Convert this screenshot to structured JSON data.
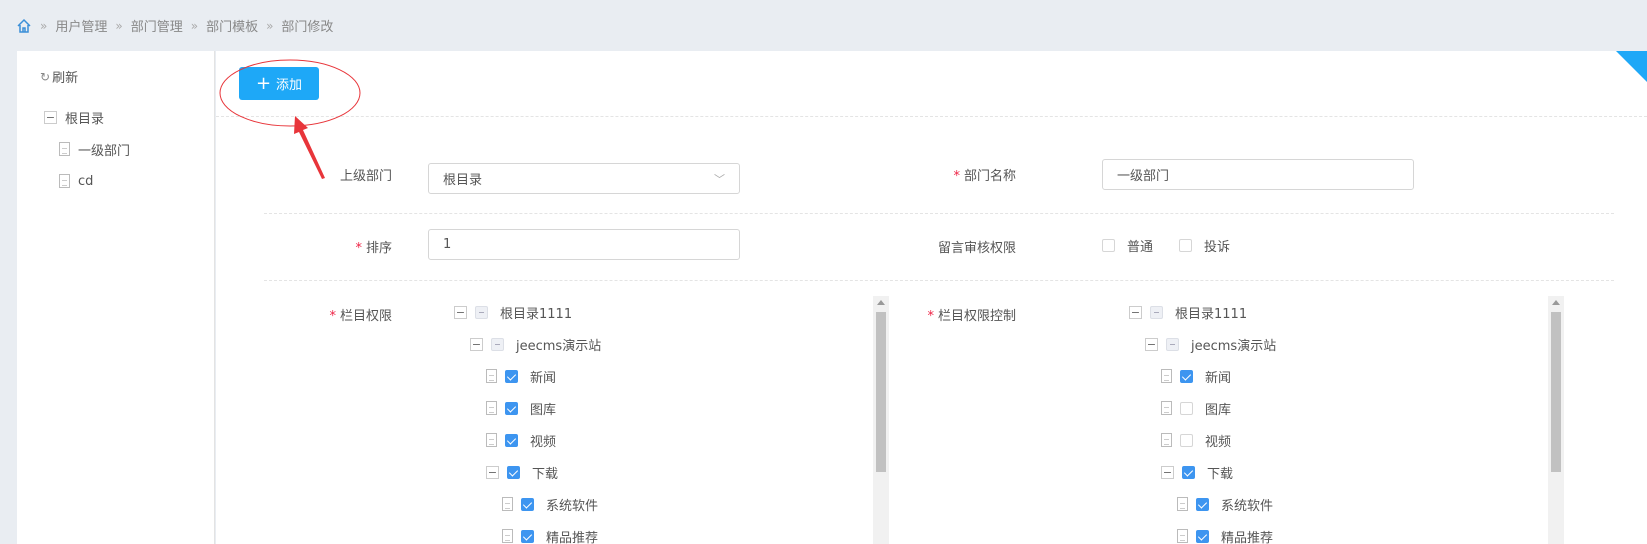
{
  "breadcrumb": [
    "用户管理",
    "部门管理",
    "部门模板",
    "部门修改"
  ],
  "sidebar": {
    "refresh": "刷新",
    "root": "根目录",
    "items": [
      "一级部门",
      "cd"
    ]
  },
  "toolbar": {
    "add_label": "添加"
  },
  "form": {
    "parent_label": "上级部门",
    "parent_value": "根目录",
    "name_label": "部门名称",
    "name_value": "一级部门",
    "order_label": "排序",
    "order_value": "1",
    "review_label": "留言审核权限",
    "review_options": [
      "普通",
      "投诉"
    ],
    "channel_label": "栏目权限",
    "channel_control_label": "栏目权限控制"
  },
  "tree_left": [
    {
      "label": "根目录1111",
      "level": 0,
      "type": "folder",
      "state": "half"
    },
    {
      "label": "jeecms演示站",
      "level": 1,
      "type": "folder",
      "state": "half"
    },
    {
      "label": "新闻",
      "level": 2,
      "type": "doc",
      "state": "on"
    },
    {
      "label": "图库",
      "level": 2,
      "type": "doc",
      "state": "on"
    },
    {
      "label": "视频",
      "level": 2,
      "type": "doc",
      "state": "on"
    },
    {
      "label": "下载",
      "level": 2,
      "type": "folder",
      "state": "on"
    },
    {
      "label": "系统软件",
      "level": 3,
      "type": "doc",
      "state": "on"
    },
    {
      "label": "精品推荐",
      "level": 3,
      "type": "doc",
      "state": "on"
    }
  ],
  "tree_right": [
    {
      "label": "根目录1111",
      "level": 0,
      "type": "folder",
      "state": "half"
    },
    {
      "label": "jeecms演示站",
      "level": 1,
      "type": "folder",
      "state": "half"
    },
    {
      "label": "新闻",
      "level": 2,
      "type": "doc",
      "state": "on"
    },
    {
      "label": "图库",
      "level": 2,
      "type": "doc",
      "state": "off"
    },
    {
      "label": "视频",
      "level": 2,
      "type": "doc",
      "state": "off"
    },
    {
      "label": "下载",
      "level": 2,
      "type": "folder",
      "state": "on"
    },
    {
      "label": "系统软件",
      "level": 3,
      "type": "doc",
      "state": "on"
    },
    {
      "label": "精品推荐",
      "level": 3,
      "type": "doc",
      "state": "on"
    }
  ],
  "colors": {
    "accent": "#1ea8f7",
    "annotation": "#e8353a"
  }
}
